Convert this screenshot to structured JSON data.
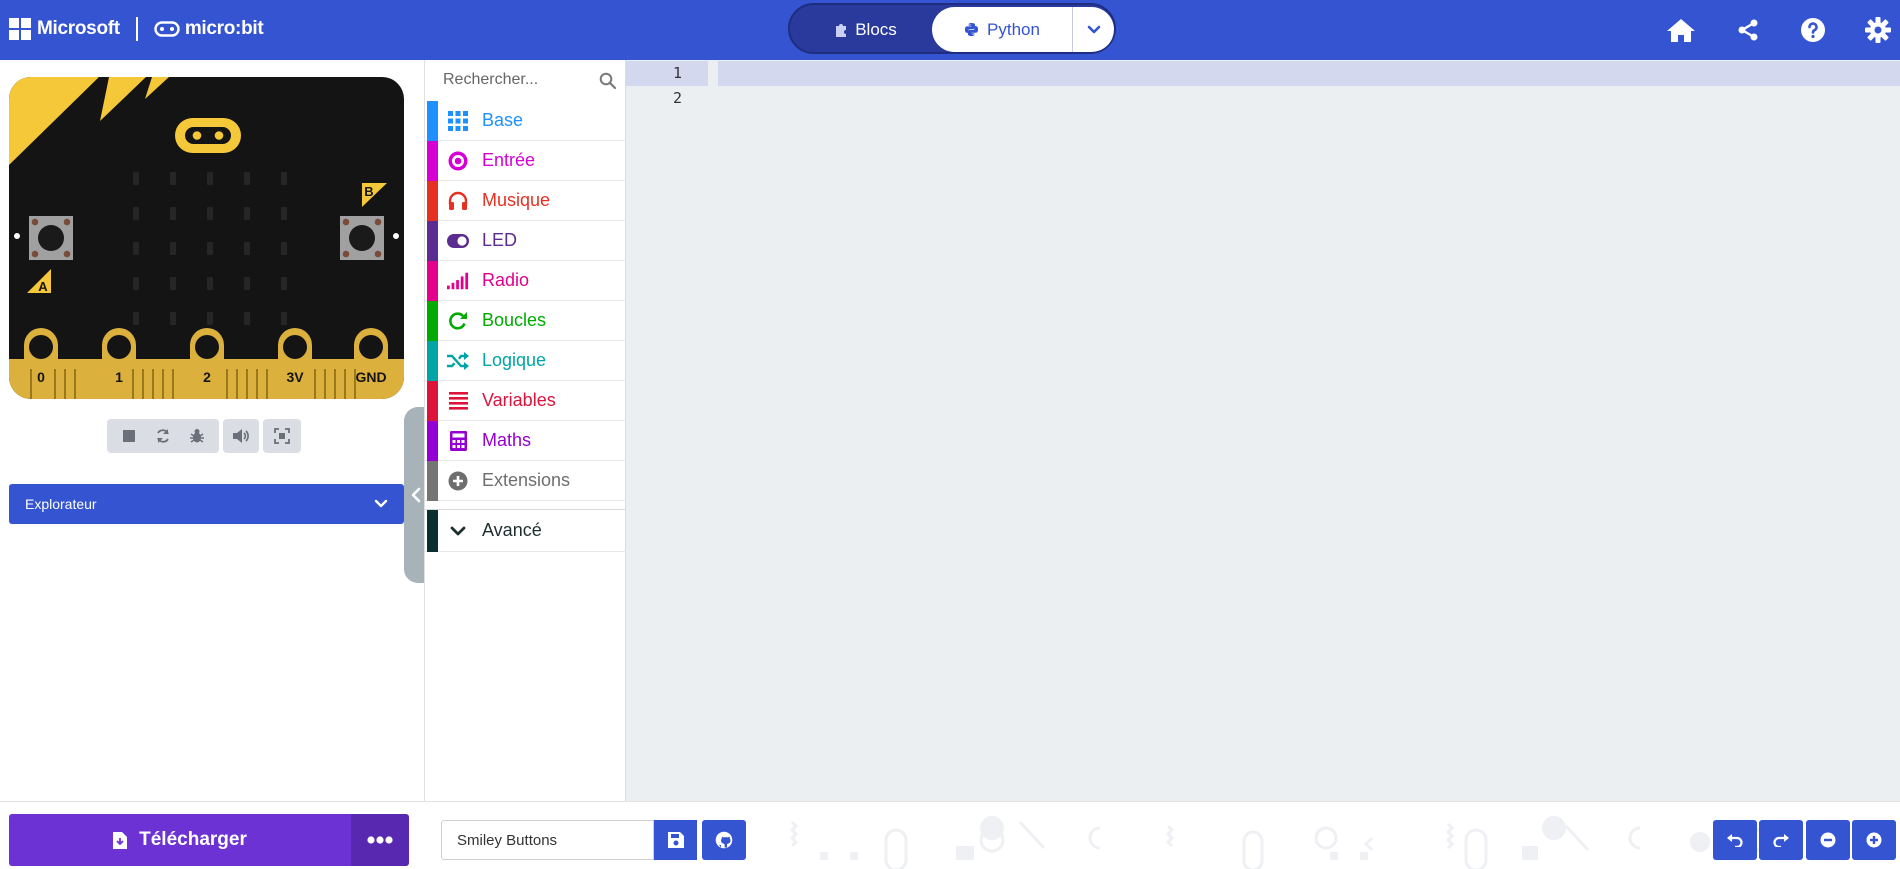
{
  "header": {
    "brand_microsoft": "Microsoft",
    "brand_microbit": "micro:bit",
    "modes": {
      "blocks_label": "Blocs",
      "python_label": "Python",
      "active": "python"
    },
    "actions": [
      "home-icon",
      "share-icon",
      "help-icon",
      "settings-icon"
    ]
  },
  "simulator": {
    "board": {
      "button_a": "A",
      "button_b": "B",
      "pins": [
        "0",
        "1",
        "2",
        "3V",
        "GND"
      ]
    },
    "controls": [
      "stop-icon",
      "restart-icon",
      "debug-icon",
      "sound-icon",
      "fullscreen-icon"
    ],
    "explorer_label": "Explorateur"
  },
  "toolbox": {
    "search_placeholder": "Rechercher...",
    "categories": [
      {
        "label": "Base",
        "color": "#1e90ff",
        "icon": "grid-icon"
      },
      {
        "label": "Entrée",
        "color": "#d400d4",
        "icon": "circle-dot-icon"
      },
      {
        "label": "Musique",
        "color": "#e63022",
        "icon": "headphones-icon"
      },
      {
        "label": "LED",
        "color": "#5c2d91",
        "icon": "toggle-icon"
      },
      {
        "label": "Radio",
        "color": "#e3008c",
        "icon": "signal-bars-icon"
      },
      {
        "label": "Boucles",
        "color": "#00aa00",
        "icon": "loop-arrow-icon"
      },
      {
        "label": "Logique",
        "color": "#00a4a6",
        "icon": "shuffle-icon"
      },
      {
        "label": "Variables",
        "color": "#dc143c",
        "icon": "lines-icon"
      },
      {
        "label": "Maths",
        "color": "#9400d3",
        "icon": "calculator-icon"
      },
      {
        "label": "Extensions",
        "color": "#757575",
        "icon": "plus-circle-icon"
      }
    ],
    "advanced": {
      "label": "Avancé",
      "color": "#0b2e2e",
      "icon": "chevron-down-icon"
    }
  },
  "editor": {
    "lines": [
      "1",
      "2"
    ],
    "active_line": 1
  },
  "footer": {
    "download_label": "Télécharger",
    "project_name": "Smiley Buttons",
    "buttons": [
      "save-icon",
      "github-icon",
      "undo-icon",
      "redo-icon",
      "zoom-out-icon",
      "zoom-in-icon"
    ]
  }
}
